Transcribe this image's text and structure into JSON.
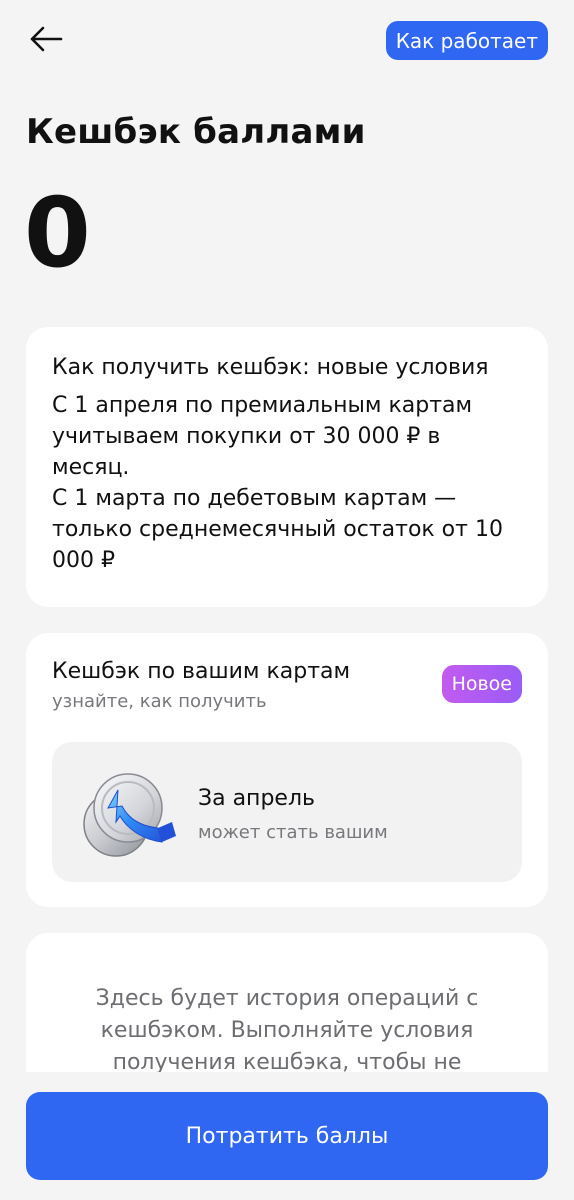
{
  "header": {
    "how_it_works_label": "Как работает"
  },
  "page": {
    "title": "Кешбэк баллами",
    "balance": "0"
  },
  "info": {
    "title": "Как получить кешбэк: новые условия",
    "body": "С 1 апреля по премиальным картам учитываем покупки от 30 000 ₽ в месяц.\nС 1 марта по дебетовым картам — только среднемесячный остаток от 10 000 ₽"
  },
  "cards_section": {
    "title": "Кешбэк по вашим картам",
    "subtitle": "узнайте, как получить",
    "badge": "Новое",
    "month": {
      "title": "За апрель",
      "subtitle": "может стать вашим",
      "icon": "coin-cashback-icon"
    }
  },
  "history": {
    "text": "Здесь будет история операций с кешбэком. Выполняйте условия получения кешбэка, чтобы не упускать"
  },
  "footer": {
    "spend_label": "Потратить баллы"
  },
  "colors": {
    "accent": "#2f66f2",
    "badge_start": "#c25bf0",
    "badge_end": "#9a5cf6",
    "background": "#f4f4f5"
  }
}
